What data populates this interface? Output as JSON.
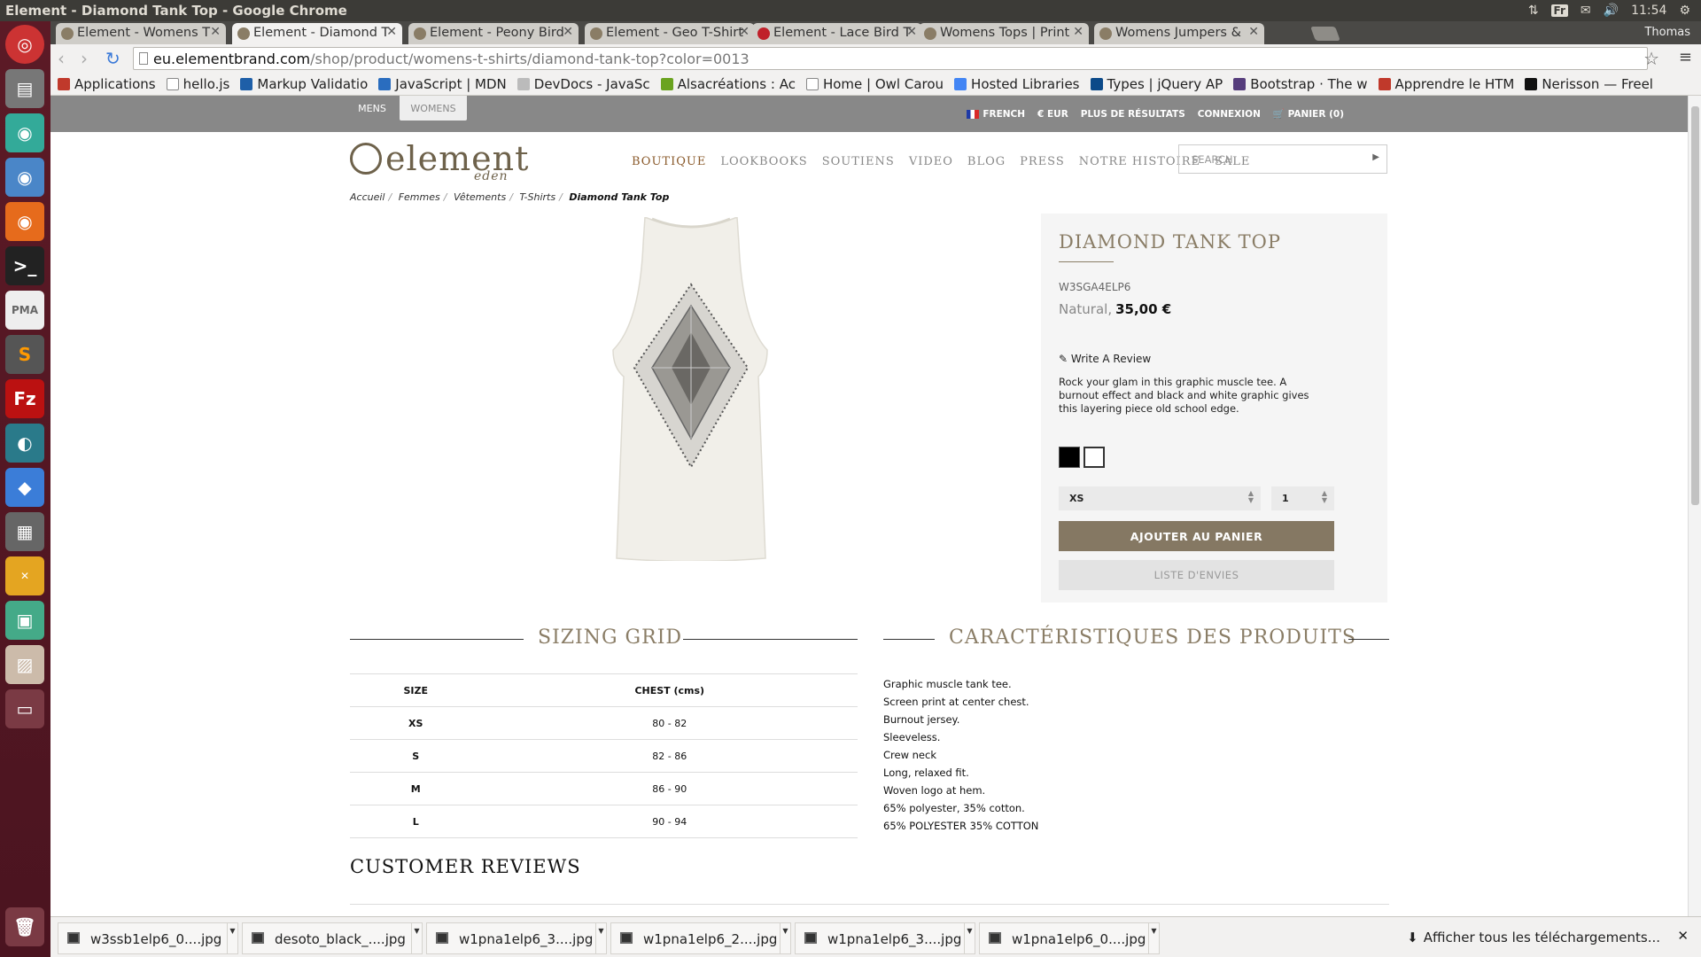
{
  "window": {
    "title": "Element - Diamond Tank Top - Google Chrome",
    "lang": "Fr",
    "time": "11:54",
    "user": "Thomas"
  },
  "tabs": [
    {
      "label": "Element - Womens T",
      "active": false
    },
    {
      "label": "Element - Diamond T",
      "active": true
    },
    {
      "label": "Element - Peony Bird",
      "active": false
    },
    {
      "label": "Element - Geo T-Shirt",
      "active": false
    },
    {
      "label": "Element - Lace Bird T",
      "active": false
    },
    {
      "label": "Womens Tops | Print",
      "active": false
    },
    {
      "label": "Womens Jumpers &",
      "active": false
    }
  ],
  "url": {
    "host": "eu.elementbrand.com",
    "path": "/shop/product/womens-t-shirts/diamond-tank-top?color=0013"
  },
  "bookmarks": [
    {
      "label": "Applications",
      "color": "#c0392b"
    },
    {
      "label": "hello.js",
      "color": "#ffffff"
    },
    {
      "label": "Markup Validatio",
      "color": "#1e5fa8"
    },
    {
      "label": "JavaScript | MDN",
      "color": "#2a6dbf"
    },
    {
      "label": "DevDocs - JavaSc",
      "color": "#bbbbbb"
    },
    {
      "label": "Alsacréations : Ac",
      "color": "#6aa31f"
    },
    {
      "label": "Home | Owl Carou",
      "color": "#ffffff"
    },
    {
      "label": "Hosted Libraries",
      "color": "#4285f4"
    },
    {
      "label": "Types | jQuery AP",
      "color": "#0c4a89"
    },
    {
      "label": "Bootstrap · The w",
      "color": "#563d7c"
    },
    {
      "label": "Apprendre le HTM",
      "color": "#c0392b"
    },
    {
      "label": "Nerisson — Freel",
      "color": "#111111"
    }
  ],
  "site": {
    "gender_tabs": [
      "MENS",
      "WOMENS"
    ],
    "util": {
      "language": "FRENCH",
      "currency": "€ EUR",
      "more_results": "PLUS DE RÉSULTATS",
      "login": "CONNEXION",
      "cart": "PANIER (0)"
    },
    "logo": "element",
    "logo_sub": "eden",
    "nav": [
      "BOUTIQUE",
      "LOOKBOOKS",
      "SOUTIENS",
      "VIDEO",
      "BLOG",
      "PRESS",
      "NOTRE HISTOIRE",
      "SALE"
    ],
    "search_placeholder": "SEARCH",
    "breadcrumb": [
      "Accueil",
      "Femmes",
      "Vêtements",
      "T-Shirts",
      "Diamond Tank Top"
    ]
  },
  "product": {
    "title": "DIAMOND TANK TOP",
    "sku": "W3SGA4ELP6",
    "color": "Natural,",
    "price": "35,00 €",
    "write_review": "Write A Review",
    "description": "Rock your glam in this graphic muscle tee. A burnout effect and black and white graphic gives this layering piece old school edge.",
    "swatches": [
      "#000000",
      "#ffffff"
    ],
    "size_selected": "XS",
    "qty_selected": "1",
    "add_to_cart": "AJOUTER AU PANIER",
    "wishlist": "LISTE D'ENVIES"
  },
  "sizing": {
    "heading": "SIZING GRID",
    "columns": [
      "SIZE",
      "CHEST (cms)"
    ],
    "rows": [
      [
        "XS",
        "80 - 82"
      ],
      [
        "S",
        "82 - 86"
      ],
      [
        "M",
        "86 - 90"
      ],
      [
        "L",
        "90 - 94"
      ]
    ]
  },
  "features": {
    "heading": "CARACTÉRISTIQUES DES PRODUITS",
    "items": [
      "Graphic muscle tank tee.",
      "Screen print at center chest.",
      "Burnout jersey.",
      "Sleeveless.",
      "Crew neck",
      "Long, relaxed fit.",
      "Woven logo at hem.",
      "65% polyester, 35% cotton.",
      "65% POLYESTER 35% COTTON"
    ]
  },
  "reviews_heading": "CUSTOMER REVIEWS",
  "downloads": {
    "items": [
      "w3ssb1elp6_0....jpg",
      "desoto_black_....jpg",
      "w1pna1elp6_3....jpg",
      "w1pna1elp6_2....jpg",
      "w1pna1elp6_3....jpg",
      "w1pna1elp6_0....jpg"
    ],
    "show_all": "Afficher tous les téléchargements..."
  }
}
